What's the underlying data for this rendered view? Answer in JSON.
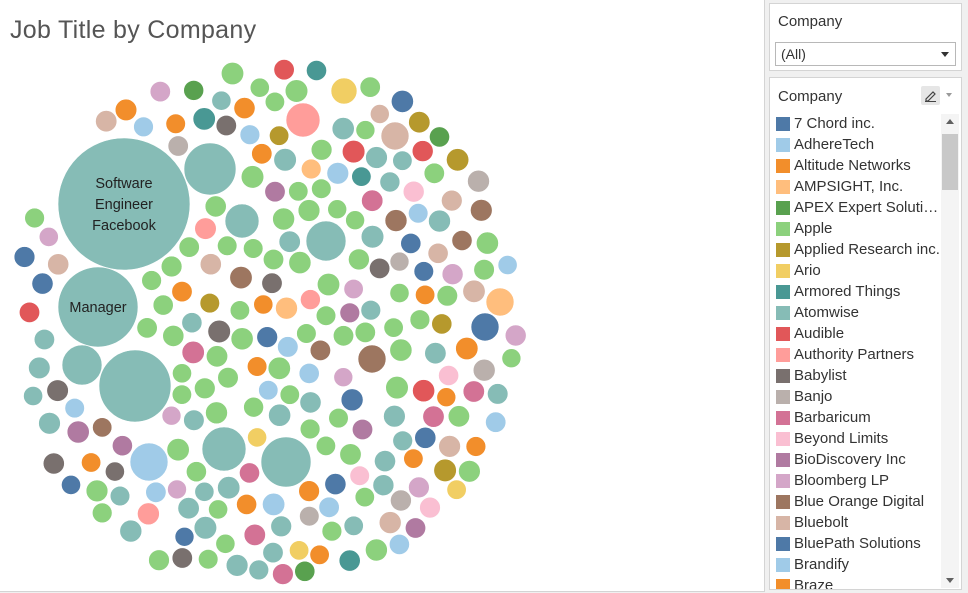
{
  "sheet": {
    "title": "Job Title by Company"
  },
  "filter": {
    "title": "Company",
    "selected": "(All)"
  },
  "legend": {
    "title": "Company",
    "edit_icon": "pen-icon",
    "items": [
      {
        "label": "7 Chord inc.",
        "color": "#4e79a7"
      },
      {
        "label": "AdhereTech",
        "color": "#a0cbe8"
      },
      {
        "label": "Altitude Networks",
        "color": "#f28e2b"
      },
      {
        "label": "AMPSIGHT, Inc.",
        "color": "#ffbe7d"
      },
      {
        "label": "APEX Expert Solutions",
        "color": "#59a14f"
      },
      {
        "label": "Apple",
        "color": "#8cd17d"
      },
      {
        "label": "Applied Research inc.",
        "color": "#b6992d"
      },
      {
        "label": "Ario",
        "color": "#f1ce63"
      },
      {
        "label": "Armored Things",
        "color": "#499894"
      },
      {
        "label": "Atomwise",
        "color": "#86bcb6"
      },
      {
        "label": "Audible",
        "color": "#e15759"
      },
      {
        "label": "Authority Partners",
        "color": "#ff9d9a"
      },
      {
        "label": "Babylist",
        "color": "#79706e"
      },
      {
        "label": "Banjo",
        "color": "#bab0ac"
      },
      {
        "label": "Barbaricum",
        "color": "#d37295"
      },
      {
        "label": "Beyond Limits",
        "color": "#fabfd2"
      },
      {
        "label": "BioDiscovery Inc",
        "color": "#b07aa1"
      },
      {
        "label": "Bloomberg LP",
        "color": "#d4a6c8"
      },
      {
        "label": "Blue Orange Digital",
        "color": "#9d7660"
      },
      {
        "label": "Bluebolt",
        "color": "#d7b5a6"
      },
      {
        "label": "BluePath Solutions",
        "color": "#4e79a7"
      },
      {
        "label": "Brandify",
        "color": "#a0cbe8"
      },
      {
        "label": "Braze",
        "color": "#f28e2b"
      }
    ]
  },
  "chart_data": {
    "type": "packed-bubble",
    "title": "Job Title by Company",
    "color_by": "Company",
    "labeled_bubbles": [
      {
        "label": "Software Engineer Facebook",
        "lines": [
          "Software",
          "Engineer",
          "Facebook"
        ],
        "color": "#86bcb6",
        "size": 1.0
      },
      {
        "label": "Manager",
        "lines": [
          "Manager"
        ],
        "color": "#86bcb6",
        "size": 0.33
      }
    ],
    "unlabeled_bubble_count": 470
  }
}
